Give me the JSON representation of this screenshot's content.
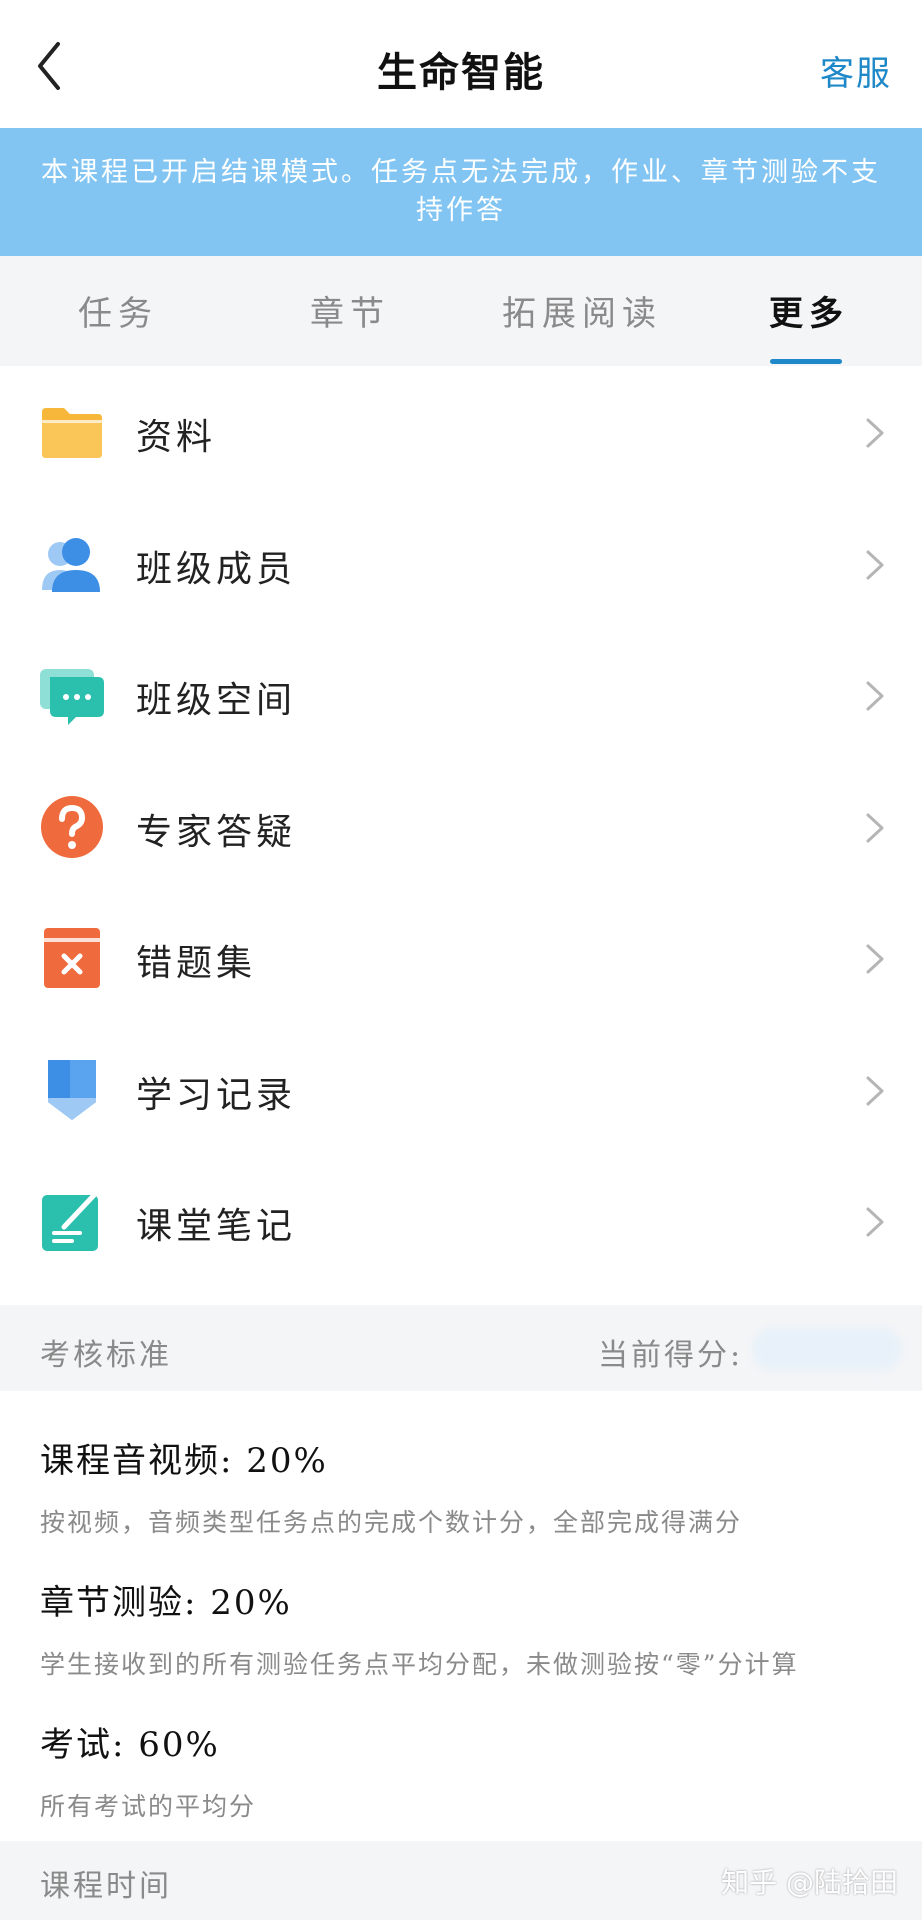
{
  "header": {
    "title": "生命智能",
    "service_label": "客服"
  },
  "notice": {
    "text": "本课程已开启结课模式。任务点无法完成，作业、章节测验不支持作答"
  },
  "tabs": [
    {
      "label": "任务",
      "active": false
    },
    {
      "label": "章节",
      "active": false
    },
    {
      "label": "拓展阅读",
      "active": false
    },
    {
      "label": "更多",
      "active": true
    }
  ],
  "menu": [
    {
      "label": "资料",
      "icon": "folder-icon",
      "color": "#f7b73b"
    },
    {
      "label": "班级成员",
      "icon": "user-icon",
      "color": "#3d8fe6"
    },
    {
      "label": "班级空间",
      "icon": "chat-icon",
      "color": "#2bbfae"
    },
    {
      "label": "专家答疑",
      "icon": "question-icon",
      "color": "#ef6a3c"
    },
    {
      "label": "错题集",
      "icon": "wrong-book-icon",
      "color": "#ef6a3c"
    },
    {
      "label": "学习记录",
      "icon": "pencil-icon",
      "color": "#3d8fe6"
    },
    {
      "label": "课堂笔记",
      "icon": "note-icon",
      "color": "#2bbfae"
    }
  ],
  "assessment": {
    "header_label": "考核标准",
    "score_label": "当前得分:",
    "items": [
      {
        "title": "课程音视频: 20%",
        "desc": "按视频，音频类型任务点的完成个数计分，全部完成得满分"
      },
      {
        "title": "章节测验: 20%",
        "desc": "学生接收到的所有测验任务点平均分配，未做测验按“零”分计算"
      },
      {
        "title": "考试: 60%",
        "desc": "所有考试的平均分"
      }
    ]
  },
  "footer": {
    "label": "课程时间",
    "watermark": "知乎 @陆拾田"
  },
  "colors": {
    "accent": "#1e88c8",
    "notice_bg": "#82c5f2",
    "section_bg": "#f4f5f7"
  }
}
